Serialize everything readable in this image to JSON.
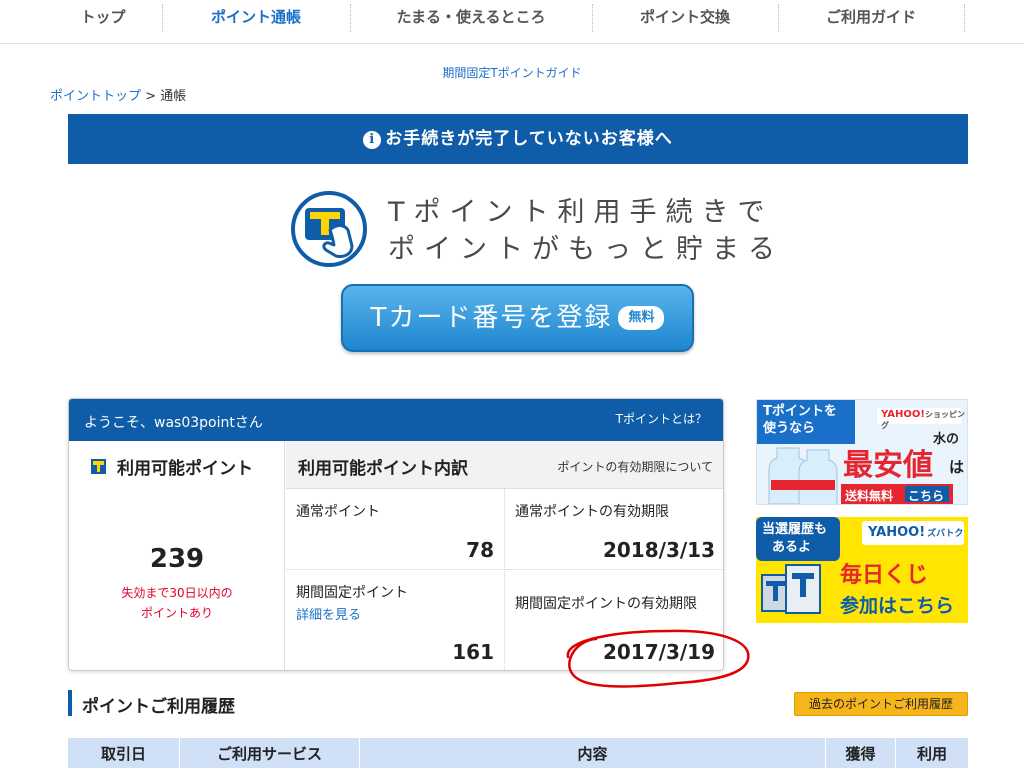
{
  "nav": {
    "items": [
      {
        "label": "トップ"
      },
      {
        "label": "ポイント通帳"
      },
      {
        "label": "たまる・使えるところ"
      },
      {
        "label": "ポイント交換"
      },
      {
        "label": "ご利用ガイド"
      }
    ],
    "active_color": "#1a6fc9"
  },
  "guide_link": "期間固定Tポイントガイド",
  "breadcrumb": {
    "home": "ポイントトップ",
    "sep": " > ",
    "current": "通帳"
  },
  "notice": {
    "icon": "info-icon",
    "text": "お手続きが完了していないお客様へ",
    "bg": "#0f5ca8"
  },
  "promo": {
    "line1": "Tポイント利用手続きで",
    "line2": "ポイントがもっと貯まる",
    "button_label": "Tカード番号を登録",
    "badge": "無料"
  },
  "points": {
    "welcome": "ようこそ、was03pointさん",
    "about_link": "Tポイントとは？",
    "available_title": "利用可能ポイント",
    "available_total": "239",
    "warning_line1": "失効まで30日以内の",
    "warning_line2": "ポイントあり",
    "breakdown_title": "利用可能ポイント内訳",
    "expiry_link": "ポイントの有効期限について",
    "normal_label": "通常ポイント",
    "normal_value": "78",
    "normal_expiry_label": "通常ポイントの有効期限",
    "normal_expiry_value": "2018/3/13",
    "fixed_label": "期間固定ポイント",
    "fixed_detail_link": "詳細を見る",
    "fixed_value": "161",
    "fixed_expiry_label": "期間固定ポイントの有効期限",
    "fixed_expiry_value": "2017/3/19"
  },
  "ads": {
    "ad1": {
      "line1": "Tポイントを",
      "line2": "使うなら",
      "brand": "YAHOO!",
      "brand_sub": "ショッピング",
      "water": "水の",
      "headline": "最安値",
      "suffix": "は",
      "shipping": "送料無料",
      "here": "こちら"
    },
    "ad2": {
      "line1": "当選履歴も",
      "line2": "あるよ",
      "brand": "YAHOO!",
      "brand_sub": "ズバトク",
      "headline": "毎日くじ",
      "cta": "参加はこちら"
    }
  },
  "history": {
    "title": "ポイントご利用履歴",
    "past_button": "過去のポイントご利用履歴",
    "columns": [
      "取引日",
      "ご利用サービス",
      "内容",
      "獲得",
      "利用"
    ]
  }
}
